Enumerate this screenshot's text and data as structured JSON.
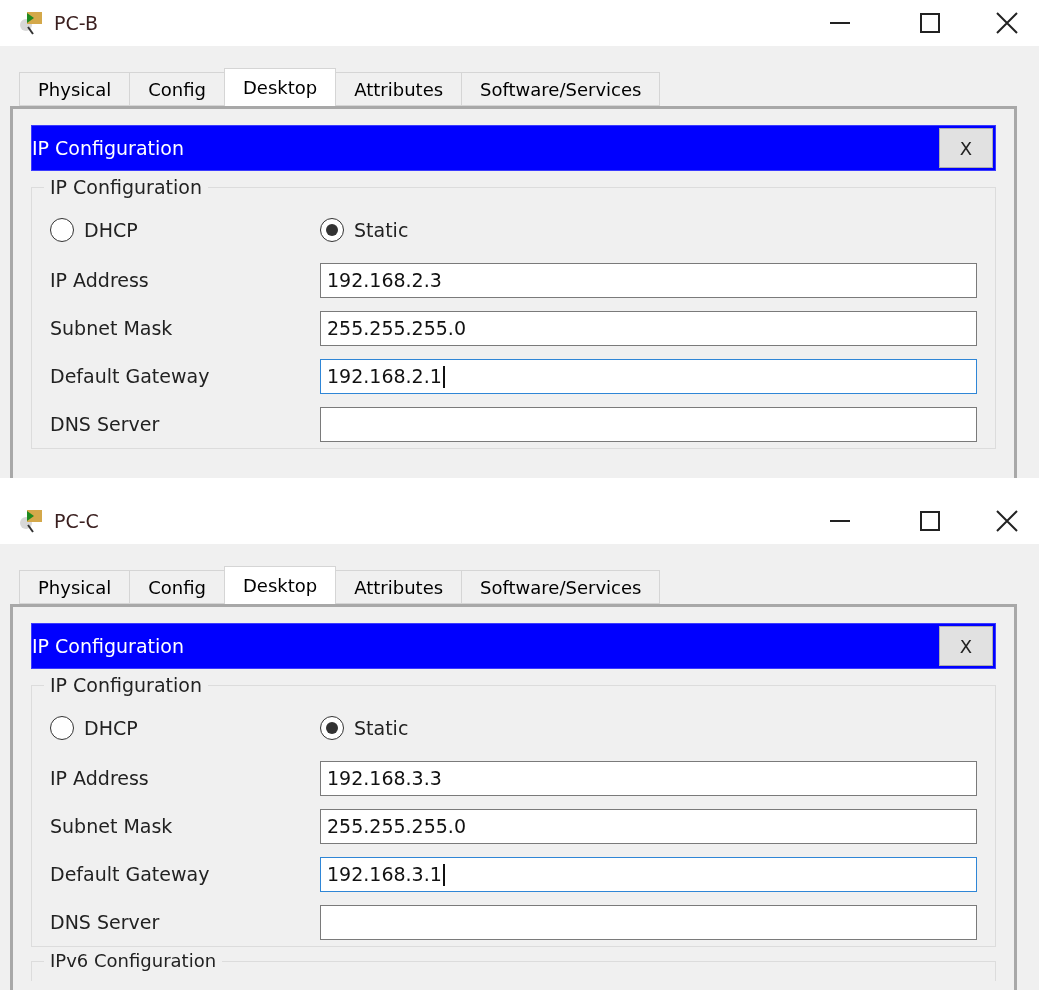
{
  "windows": [
    {
      "title": "PC-B",
      "tabs": [
        {
          "label": "Physical",
          "selected": false
        },
        {
          "label": "Config",
          "selected": false
        },
        {
          "label": "Desktop",
          "selected": true
        },
        {
          "label": "Attributes",
          "selected": false
        },
        {
          "label": "Software/Services",
          "selected": false
        }
      ],
      "panel": {
        "title": "IP Configuration",
        "close": "X",
        "group": "IP Configuration",
        "modes": [
          {
            "label": "DHCP",
            "selected": false
          },
          {
            "label": "Static",
            "selected": true
          }
        ],
        "fields": [
          {
            "label": "IP Address",
            "value": "192.168.2.3",
            "focused": false
          },
          {
            "label": "Subnet Mask",
            "value": "255.255.255.0",
            "focused": false
          },
          {
            "label": "Default Gateway",
            "value": "192.168.2.1",
            "focused": true
          },
          {
            "label": "DNS Server",
            "focused": false
          }
        ]
      }
    },
    {
      "title": "PC-C",
      "tabs": [
        {
          "label": "Physical",
          "selected": false
        },
        {
          "label": "Config",
          "selected": false
        },
        {
          "label": "Desktop",
          "selected": true
        },
        {
          "label": "Attributes",
          "selected": false
        },
        {
          "label": "Software/Services",
          "selected": false
        }
      ],
      "panel": {
        "title": "IP Configuration",
        "close": "X",
        "group": "IP Configuration",
        "modes": [
          {
            "label": "DHCP",
            "selected": false
          },
          {
            "label": "Static",
            "selected": true
          }
        ],
        "fields": [
          {
            "label": "IP Address",
            "value": "192.168.3.3",
            "focused": false
          },
          {
            "label": "Subnet Mask",
            "value": "255.255.255.0",
            "focused": false
          },
          {
            "label": "Default Gateway",
            "value": "192.168.3.1",
            "focused": true
          },
          {
            "label": "DNS Server",
            "focused": false
          }
        ],
        "next_group": "IPv6 Configuration"
      }
    }
  ]
}
